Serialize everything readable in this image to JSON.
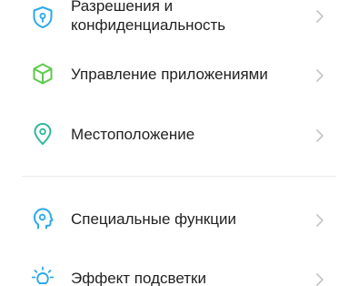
{
  "settings": {
    "items": [
      {
        "label_line1": "Разрешения и",
        "label_line2": "конфиденциальность",
        "icon": "shield-icon",
        "color": "#2aa9ec"
      },
      {
        "label": "Управление приложениями",
        "icon": "cube-icon",
        "color": "#5cc94a"
      },
      {
        "label": "Местоположение",
        "icon": "location-pin-icon",
        "color": "#2db89a"
      },
      {
        "label": "Специальные функции",
        "icon": "head-accessibility-icon",
        "color": "#2aa9ec"
      },
      {
        "label": "Эффект подсветки",
        "icon": "lightbulb-icon",
        "color": "#2aa9ec"
      }
    ]
  },
  "colors": {
    "text": "#222222",
    "chevron": "#c4c4c4",
    "divider": "#ececec",
    "blue": "#2aa9ec",
    "green": "#5cc94a",
    "teal": "#2db89a"
  }
}
